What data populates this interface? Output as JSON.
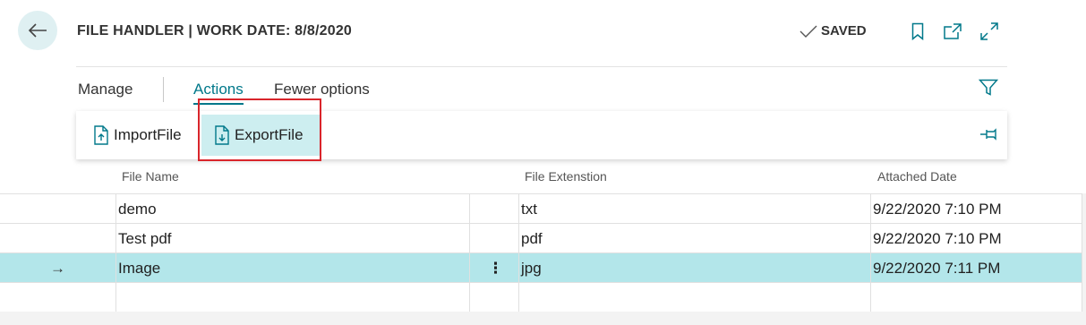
{
  "header": {
    "back_icon": "arrow-left-icon",
    "title": "FILE HANDLER | WORK DATE: 8/8/2020",
    "saved_label": "SAVED",
    "icons": [
      "bookmark-icon",
      "open-new-window-icon",
      "expand-icon"
    ]
  },
  "menu": {
    "tabs": [
      "Manage",
      "Actions",
      "Fewer options"
    ],
    "active_tab": "Actions"
  },
  "actions": {
    "import_label": "ImportFile",
    "export_label": "ExportFile",
    "highlighted": "ExportFile"
  },
  "table": {
    "columns": [
      "File Name",
      "File Extenstion",
      "Attached Date"
    ],
    "rows": [
      {
        "name": "demo",
        "ext": "txt",
        "date": "9/22/2020 7:10 PM"
      },
      {
        "name": "Test pdf",
        "ext": "pdf",
        "date": "9/22/2020 7:10 PM"
      },
      {
        "name": "Image",
        "ext": "jpg",
        "date": "9/22/2020 7:11 PM",
        "selected": true,
        "row_marker": "→",
        "row_menu": "⋮"
      }
    ]
  },
  "colors": {
    "accent": "#00788a",
    "selected_row": "#b3e6ea",
    "highlight_box": "#d9252b",
    "back_button_bg": "#dff0f2"
  }
}
